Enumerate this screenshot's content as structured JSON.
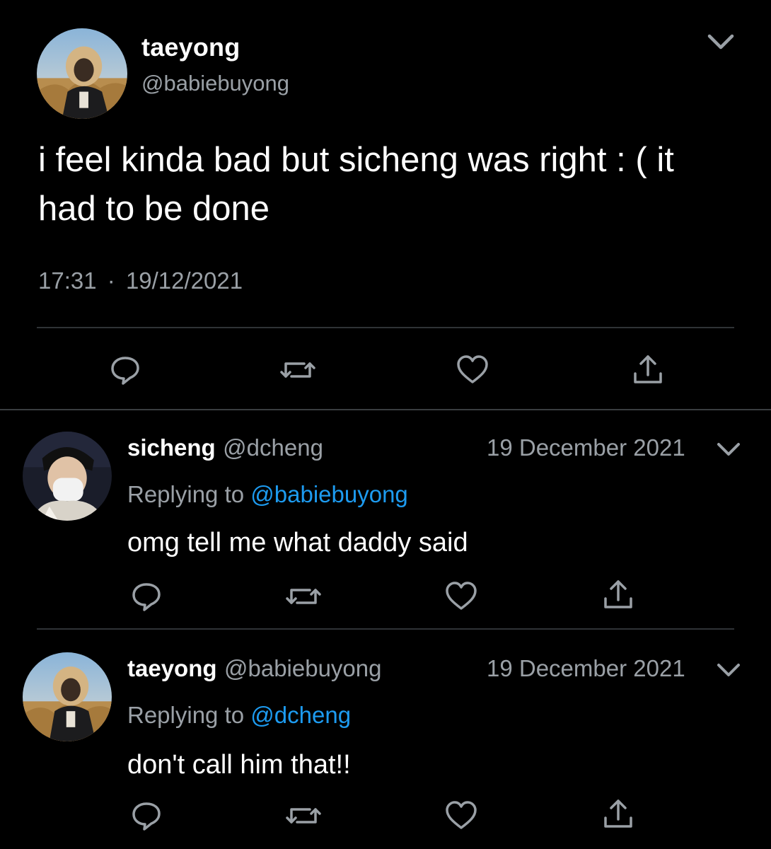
{
  "main_tweet": {
    "author_name": "taeyong",
    "author_handle": "@babiebuyong",
    "text": "i feel kinda bad but sicheng was right : ( it had to be done",
    "time": "17:31",
    "separator": "·",
    "date": "19/12/2021",
    "icons": [
      "more-chevron-icon",
      "reply-icon",
      "retweet-icon",
      "like-icon",
      "share-icon"
    ]
  },
  "replies": [
    {
      "author_name": "sicheng",
      "author_handle": "@dcheng",
      "date": "19 December 2021",
      "replying_prefix": "Replying to",
      "replying_to": "@babiebuyong",
      "text": "omg tell me what daddy said"
    },
    {
      "author_name": "taeyong",
      "author_handle": "@babiebuyong",
      "date": "19 December 2021",
      "replying_prefix": "Replying to",
      "replying_to": "@dcheng",
      "text": "don't call him that!!"
    }
  ],
  "colors": {
    "background": "#000000",
    "primary_text": "#ffffff",
    "secondary_text": "#9aa0a6",
    "link": "#1d9bf0",
    "divider": "#2f3336"
  }
}
